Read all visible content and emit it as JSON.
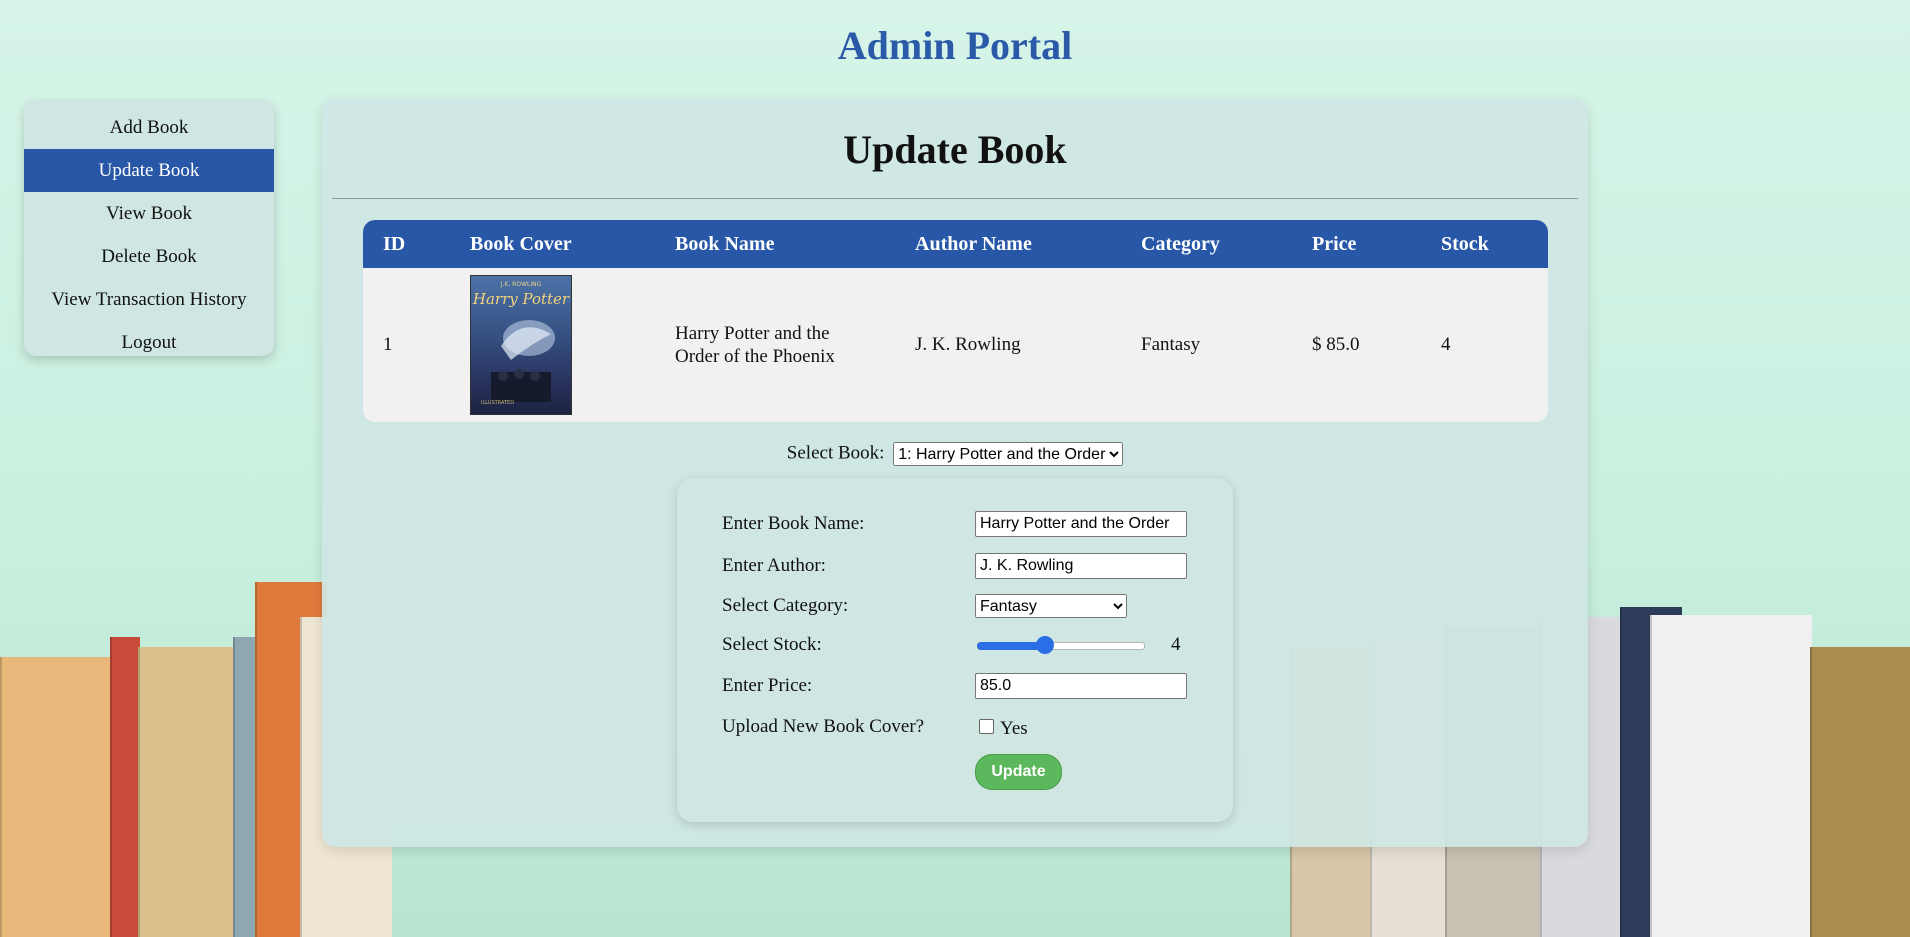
{
  "header": {
    "title": "Admin Portal"
  },
  "sidebar": {
    "items": [
      {
        "label": "Add Book"
      },
      {
        "label": "Update Book",
        "active": true
      },
      {
        "label": "View Book"
      },
      {
        "label": "Delete Book"
      },
      {
        "label": "View Transaction History"
      },
      {
        "label": "Logout"
      }
    ]
  },
  "main": {
    "title": "Update Book",
    "table": {
      "headers": [
        "ID",
        "Book Cover",
        "Book Name",
        "Author Name",
        "Category",
        "Price",
        "Stock"
      ],
      "rows": [
        {
          "id": "1",
          "cover_icon": "harry-potter-cover-image",
          "name": "Harry Potter and the Order of the Phoenix",
          "author": "J. K. Rowling",
          "category": "Fantasy",
          "price": "$ 85.0",
          "stock": "4"
        }
      ]
    },
    "select_book": {
      "label": "Select Book:",
      "value": "1: Harry Potter and the Order"
    },
    "form": {
      "name_label": "Enter Book Name:",
      "name_value": "Harry Potter and the Order",
      "author_label": "Enter Author:",
      "author_value": "J. K. Rowling",
      "category_label": "Select Category:",
      "category_value": "Fantasy",
      "stock_label": "Select Stock:",
      "stock_value": "4",
      "stock_fraction": 0.4,
      "price_label": "Enter Price:",
      "price_value": "85.0",
      "cover_label": "Upload New Book Cover?",
      "cover_option": "Yes",
      "cover_checked": false,
      "submit_label": "Update"
    }
  },
  "colors": {
    "accent": "#2757a6",
    "title": "#2a5aa8",
    "button": "#5cb85c",
    "slider": "#2b6fe6"
  }
}
